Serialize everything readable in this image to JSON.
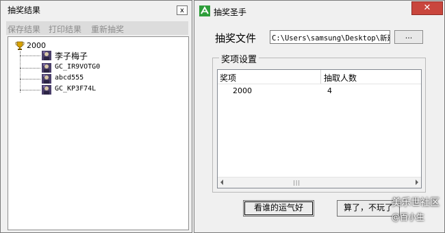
{
  "results_window": {
    "title": "抽奖结果",
    "close_label": "x",
    "menu": [
      "保存结果",
      "打印结果",
      "重新抽奖"
    ],
    "tree": {
      "root": "2000",
      "children": [
        "李子梅子",
        "GC_IR9VOTG0",
        "abcd555",
        "GC_KP3F74L"
      ]
    }
  },
  "main_window": {
    "title": "抽奖圣手",
    "close_label": "✕",
    "file_label": "抽奖文件",
    "file_path": "C:\\Users\\samsung\\Desktop\\新建",
    "browse_label": "...",
    "group_title": "奖项设置",
    "list": {
      "columns": [
        "奖项",
        "抽取人数"
      ],
      "rows": [
        {
          "prize": "2000",
          "count": "4"
        }
      ]
    },
    "buttons": {
      "lucky": "看谁的运气好",
      "quit": "算了，不玩了"
    }
  },
  "watermark": {
    "line1": "美乐世社区",
    "line2": "@百小生"
  },
  "icons": [
    "trophy-icon",
    "person-icon",
    "app-logo-icon"
  ]
}
